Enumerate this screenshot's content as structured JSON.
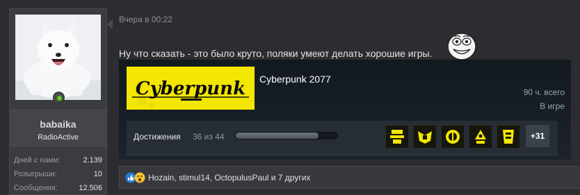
{
  "user": {
    "username": "babaika",
    "title": "RadioActive",
    "stats": [
      {
        "label": "Дней с нами:",
        "value": "2.139"
      },
      {
        "label": "Розыгрыши:",
        "value": "10"
      },
      {
        "label": "Сообщения:",
        "value": "12.506"
      }
    ]
  },
  "post": {
    "timestamp": "Вчера в 00:22",
    "text": "Ну что сказать - это было круто, поляки умеют делать хорошие игры."
  },
  "steam": {
    "logo_text": "Cyberpunk",
    "game_name": "Cyberpunk 2077",
    "hours": "90 ч. всего",
    "status": "В игре",
    "achievements_label": "Достижения",
    "achievements_count": "36 из 44",
    "achievements_progress": 0.818,
    "more_label": "+31"
  },
  "reactions": {
    "names": "Hozain, stimul14, OctopulusPaul и 7 других"
  },
  "colors": {
    "page_bg": "#2b2d30",
    "brand_yellow": "#f3e600",
    "online_green": "#6fc02d"
  }
}
